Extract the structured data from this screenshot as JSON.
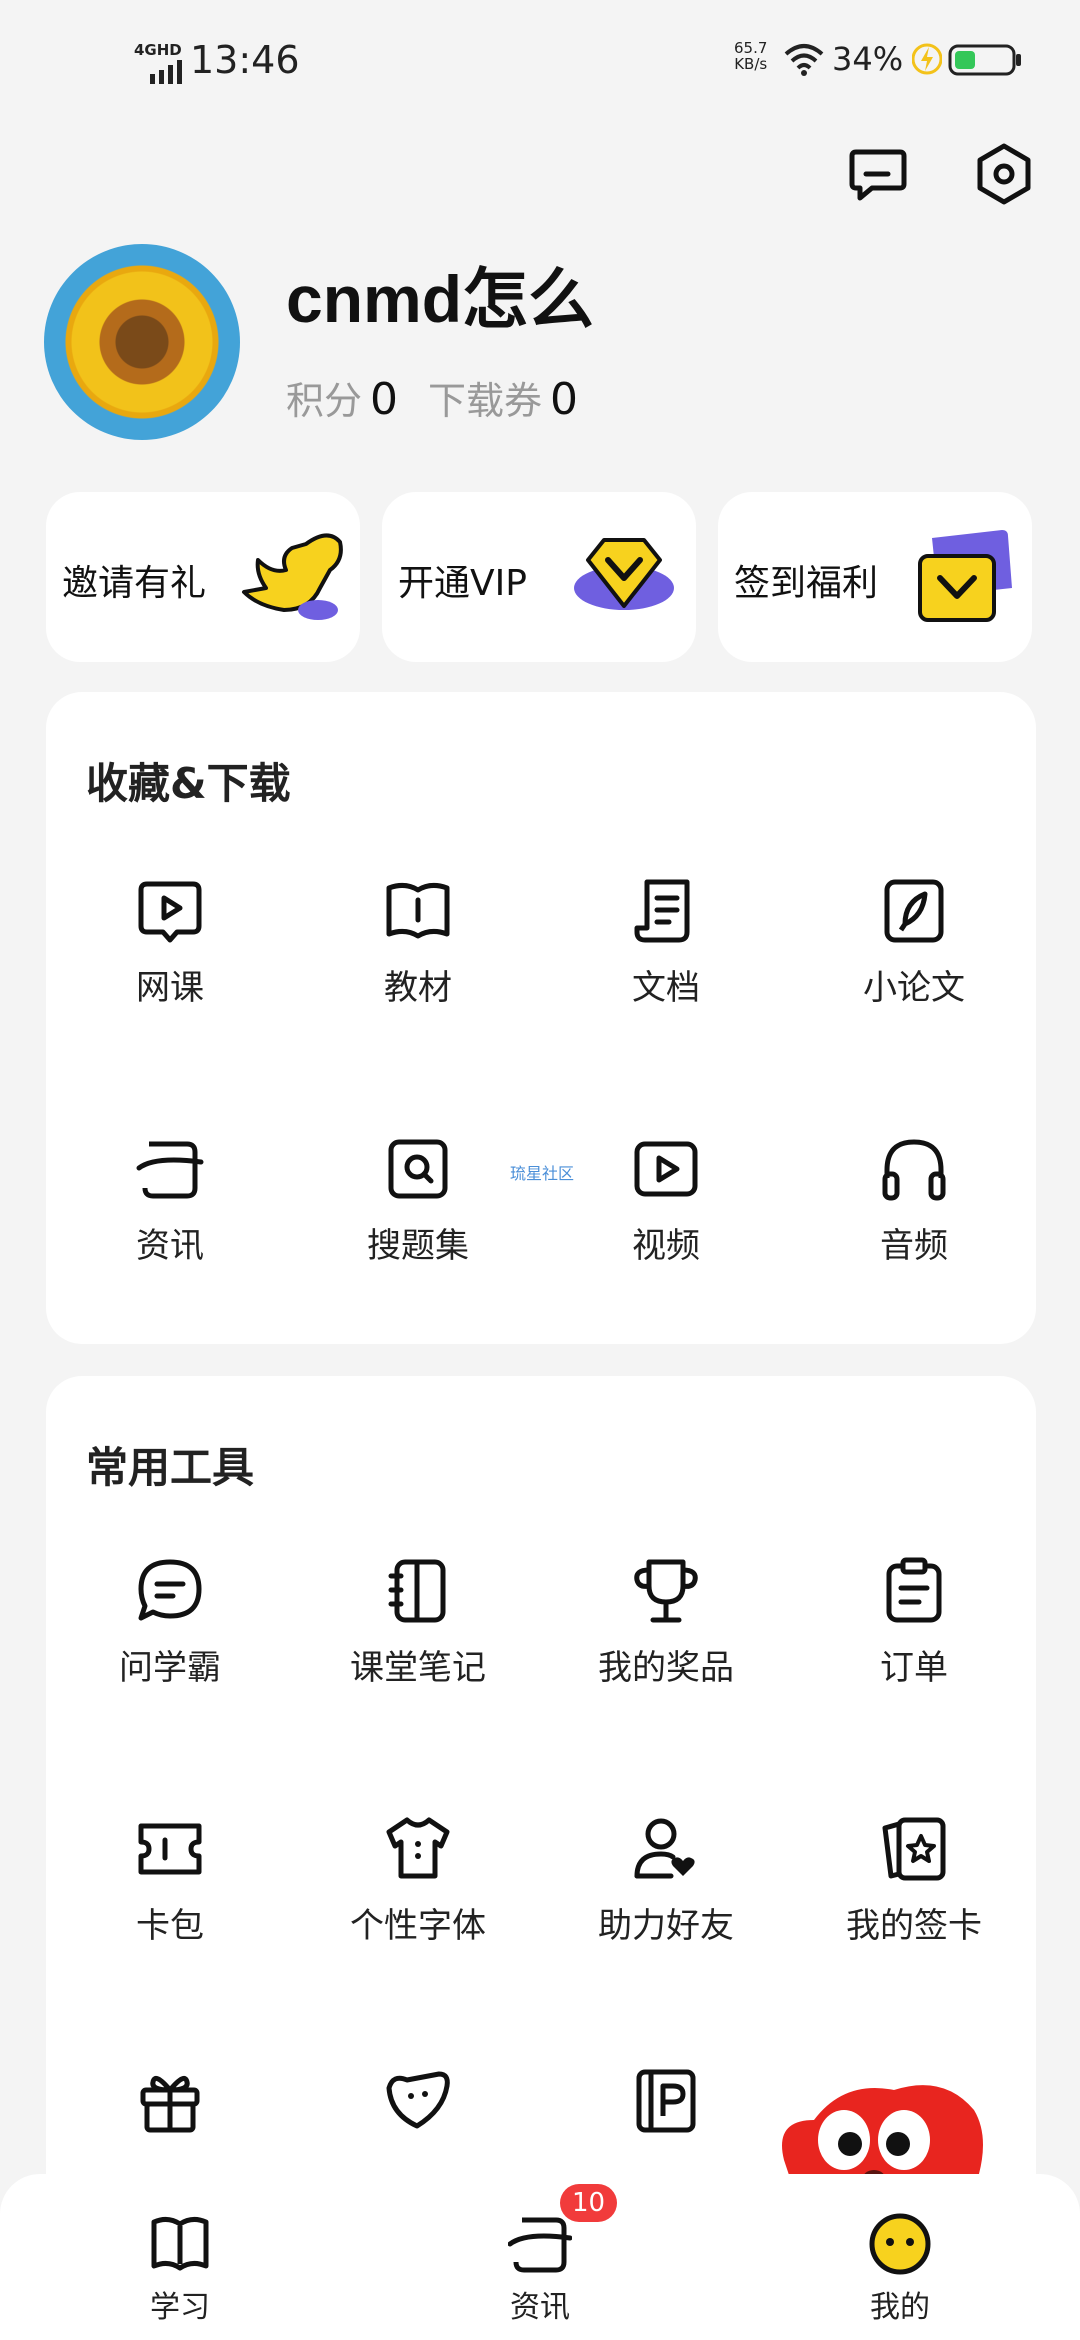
{
  "status_bar": {
    "network": "4GHD",
    "time": "13:46",
    "speed_value": "65.7",
    "speed_unit": "KB/s",
    "battery": "34%"
  },
  "profile": {
    "username": "cnmd怎么",
    "points_label": "积分",
    "points_value": "0",
    "vouchers_label": "下载券",
    "vouchers_value": "0"
  },
  "promos": [
    {
      "label": "邀请有礼"
    },
    {
      "label": "开通VIP"
    },
    {
      "label": "签到福利"
    }
  ],
  "favorites": {
    "title": "收藏&下载",
    "items": [
      {
        "label": "网课",
        "icon": "video-lesson-icon"
      },
      {
        "label": "教材",
        "icon": "book-icon"
      },
      {
        "label": "文档",
        "icon": "document-icon"
      },
      {
        "label": "小论文",
        "icon": "pen-icon"
      },
      {
        "label": "资讯",
        "icon": "news-icon"
      },
      {
        "label": "搜题集",
        "icon": "search-question-icon"
      },
      {
        "label": "视频",
        "icon": "video-icon"
      },
      {
        "label": "音频",
        "icon": "headphones-icon"
      }
    ],
    "watermark": "琉星社区"
  },
  "tools": {
    "title": "常用工具",
    "items": [
      {
        "label": "问学霸",
        "icon": "chat-icon"
      },
      {
        "label": "课堂笔记",
        "icon": "notebook-icon"
      },
      {
        "label": "我的奖品",
        "icon": "trophy-icon"
      },
      {
        "label": "订单",
        "icon": "clipboard-icon"
      },
      {
        "label": "卡包",
        "icon": "ticket-icon"
      },
      {
        "label": "个性字体",
        "icon": "tshirt-icon"
      },
      {
        "label": "助力好友",
        "icon": "friend-heart-icon"
      },
      {
        "label": "我的签卡",
        "icon": "star-card-icon"
      }
    ]
  },
  "bottom_nav": [
    {
      "label": "学习",
      "icon": "book-icon"
    },
    {
      "label": "资讯",
      "icon": "news-icon"
    },
    {
      "label": "我的",
      "icon": "smiley-icon"
    }
  ],
  "news_badge": "10",
  "colors": {
    "accent_yellow": "#f7d21e",
    "purple": "#6f5fe0",
    "badge_red": "#f13b3b"
  }
}
